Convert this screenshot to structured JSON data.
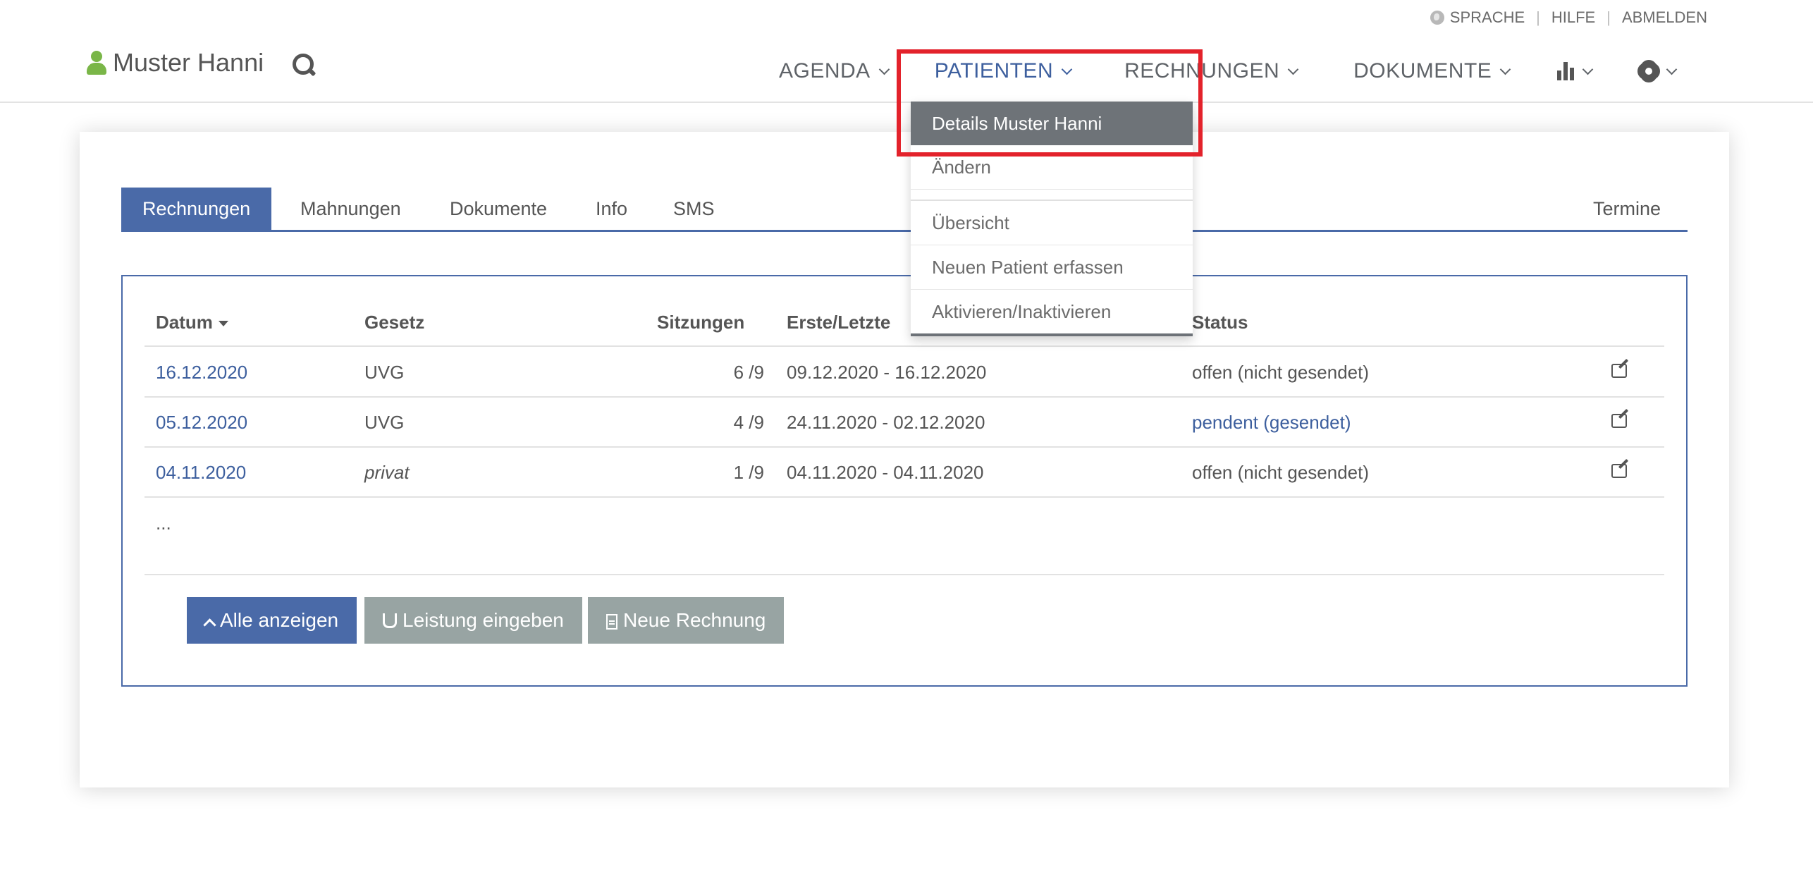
{
  "utility": {
    "sprache": "SPRACHE",
    "hilfe": "HILFE",
    "abmelden": "ABMELDEN"
  },
  "header": {
    "user_name": "Muster Hanni"
  },
  "nav": {
    "agenda": "AGENDA",
    "patienten": "PATIENTEN",
    "rechnungen": "RECHNUNGEN",
    "dokumente": "DOKUMENTE"
  },
  "dropdown": {
    "details": "Details Muster Hanni",
    "aendern": "Ändern",
    "uebersicht": "Übersicht",
    "neuen_patient": "Neuen Patient erfassen",
    "aktivieren": "Aktivieren/Inaktivieren"
  },
  "tabs": {
    "rechnungen": "Rechnungen",
    "mahnungen": "Mahnungen",
    "dokumente": "Dokumente",
    "info": "Info",
    "sms": "SMS",
    "termine": "Termine"
  },
  "table": {
    "headers": {
      "datum": "Datum",
      "gesetz": "Gesetz",
      "sitzungen": "Sitzungen",
      "erste_letzte": "Erste/Letzte",
      "status": "Status"
    },
    "rows": [
      {
        "datum": "16.12.2020",
        "gesetz": "UVG",
        "sitzungen": "6 /9",
        "range": "09.12.2020 - 16.12.2020",
        "status": "offen (nicht gesendet)"
      },
      {
        "datum": "05.12.2020",
        "gesetz": "UVG",
        "sitzungen": "4 /9",
        "range": "24.11.2020 - 02.12.2020",
        "status": "pendent (gesendet)"
      },
      {
        "datum": "04.11.2020",
        "gesetz": "privat",
        "sitzungen": "1 /9",
        "range": "04.11.2020 - 04.11.2020",
        "status": "offen (nicht gesendet)"
      }
    ],
    "more": "..."
  },
  "buttons": {
    "alle_anzeigen": "Alle anzeigen",
    "leistung": "Leistung eingeben",
    "neue_rechnung": "Neue Rechnung"
  },
  "colors": {
    "primary": "#4a6aa8",
    "secondary": "#98a4a3",
    "highlight": "#e3222b",
    "user_icon": "#7ab648"
  }
}
